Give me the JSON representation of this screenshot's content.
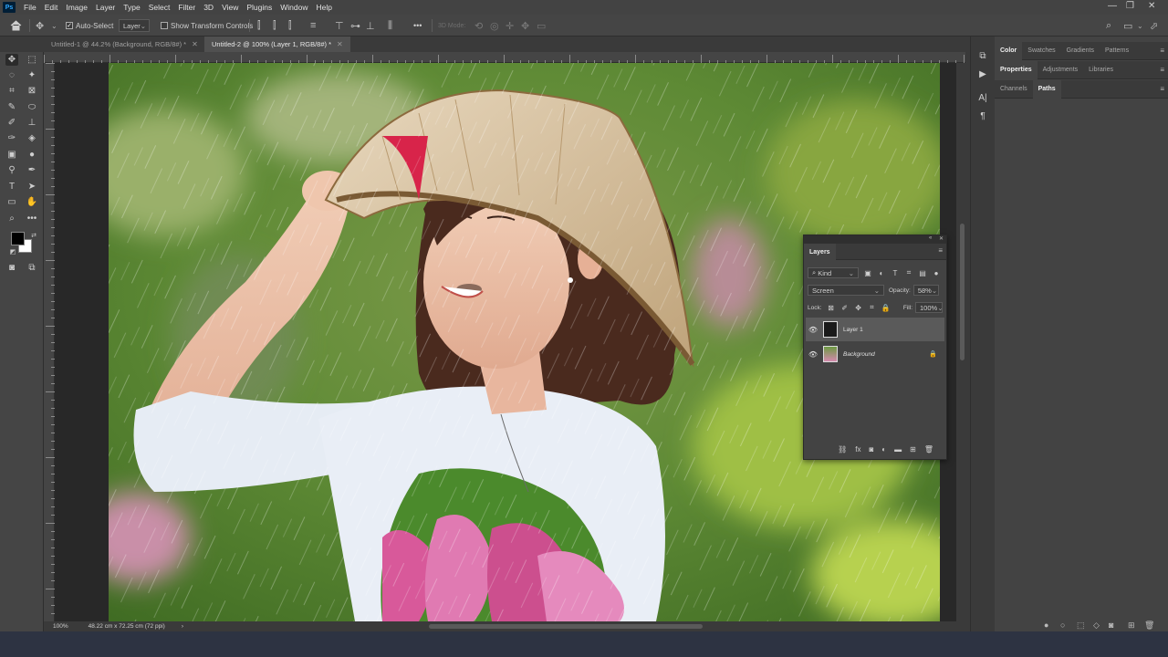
{
  "app": {
    "logo": "Ps",
    "menu": [
      "File",
      "Edit",
      "Image",
      "Layer",
      "Type",
      "Select",
      "Filter",
      "3D",
      "View",
      "Plugins",
      "Window",
      "Help"
    ],
    "window_controls": {
      "minimize": "—",
      "restore": "❐",
      "close": "✕"
    }
  },
  "options_bar": {
    "home_icon": "home-icon",
    "move_tool_icon": "move-icon",
    "auto_select_label": "Auto-Select",
    "auto_select_checked": true,
    "auto_select_target": "Layer",
    "show_transform_label": "Show Transform Controls",
    "more_label": "•••",
    "mode_3d_label": "3D Mode:"
  },
  "doc_tabs": [
    {
      "label": "Untitled-1 @ 44.2% (Background, RGB/8#) *",
      "active": false
    },
    {
      "label": "Untitled-2 @ 100% (Layer 1, RGB/8#) *",
      "active": true
    }
  ],
  "tools": {
    "foreground_color": "#000000",
    "background_color": "#ffffff"
  },
  "status_bar": {
    "zoom": "100%",
    "doc_size": "48.22 cm x 72.25 cm (72 ppi)",
    "arrow": "›"
  },
  "right_panels": {
    "group1_tabs": [
      "Color",
      "Swatches",
      "Gradients",
      "Patterns"
    ],
    "group1_active": "Color",
    "group2_tabs": [
      "Properties",
      "Adjustments",
      "Libraries"
    ],
    "group2_active": "Properties",
    "group3_tabs": [
      "Channels",
      "Paths"
    ],
    "group3_active": "Paths",
    "panel_menu": "≡"
  },
  "layers_panel": {
    "title": "Layers",
    "filter_kind": "Kind",
    "blend_mode": "Screen",
    "opacity_label": "Opacity:",
    "opacity_value": "58%",
    "lock_label": "Lock:",
    "fill_label": "Fill:",
    "fill_value": "100%",
    "layers": [
      {
        "name": "Layer 1",
        "visible": true,
        "selected": true,
        "locked": false
      },
      {
        "name": "Background",
        "visible": true,
        "selected": false,
        "locked": true
      }
    ]
  },
  "colors": {
    "app_bg": "#3a3a3a",
    "panel_bg": "#434343",
    "selected_layer": "#5a5a5a",
    "ps_blue": "#31a8ff"
  }
}
